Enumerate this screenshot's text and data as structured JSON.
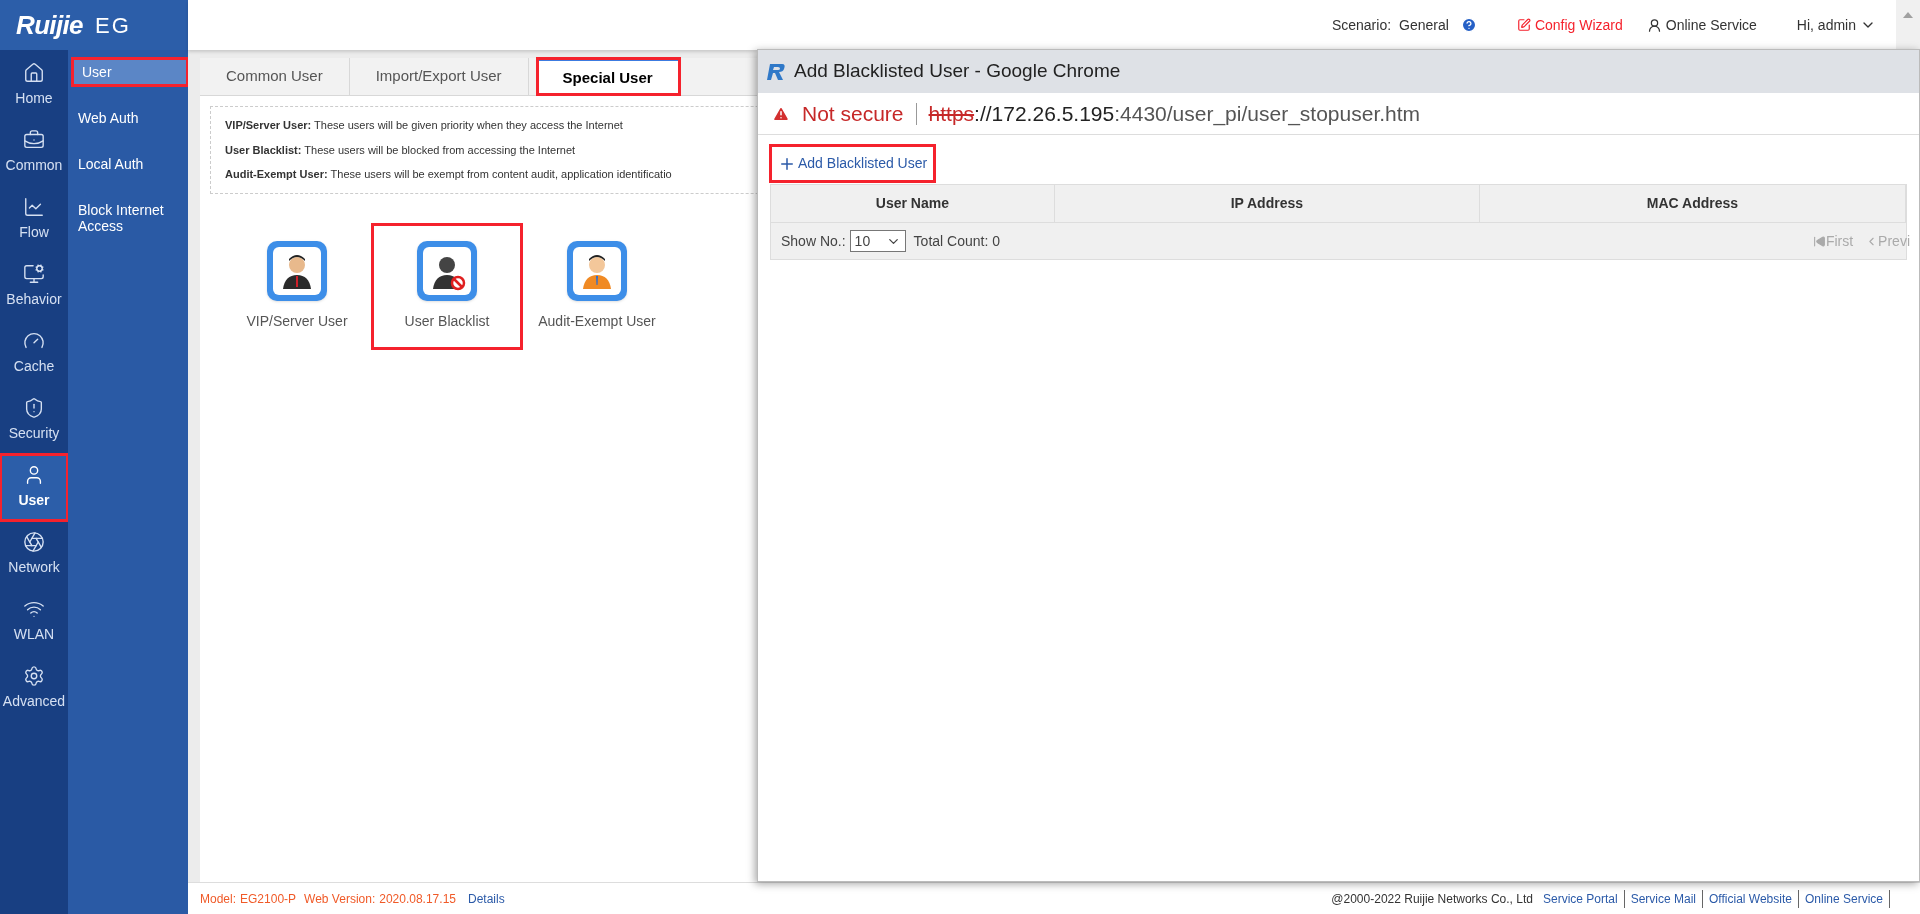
{
  "brand": {
    "logo": "Ruijie",
    "product": "EG"
  },
  "nav": [
    {
      "label": "Home",
      "selected": false,
      "highlighted": false
    },
    {
      "label": "Common",
      "selected": false,
      "highlighted": false
    },
    {
      "label": "Flow",
      "selected": false,
      "highlighted": false
    },
    {
      "label": "Behavior",
      "selected": false,
      "highlighted": false
    },
    {
      "label": "Cache",
      "selected": false,
      "highlighted": false
    },
    {
      "label": "Security",
      "selected": false,
      "highlighted": false
    },
    {
      "label": "User",
      "selected": true,
      "highlighted": true
    },
    {
      "label": "Network",
      "selected": false,
      "highlighted": false
    },
    {
      "label": "WLAN",
      "selected": false,
      "highlighted": false
    },
    {
      "label": "Advanced",
      "selected": false,
      "highlighted": false
    }
  ],
  "subnav": [
    {
      "label": "User",
      "selected": true,
      "highlighted": true
    },
    {
      "label": "Web Auth",
      "selected": false,
      "highlighted": false
    },
    {
      "label": "Local Auth",
      "selected": false,
      "highlighted": false
    },
    {
      "label": "Block Internet Access",
      "selected": false,
      "highlighted": false
    }
  ],
  "topbar": {
    "scenario_label": "Scenario:",
    "scenario_value": "General",
    "config_wizard": "Config Wizard",
    "online_service": "Online Service",
    "user_menu": "Hi, admin"
  },
  "tabs": [
    {
      "label": "Common User",
      "selected": false,
      "highlighted": false
    },
    {
      "label": "Import/Export User",
      "selected": false,
      "highlighted": false
    },
    {
      "label": "Special User",
      "selected": true,
      "highlighted": true
    }
  ],
  "info": [
    "**VIP/Server User:**  These users will be given priority when they access the Internet",
    "**User Blacklist:** These users will be blocked from accessing the Internet",
    "**Audit-Exempt User:** These users will be exempt from content audit, application identificatio"
  ],
  "tiles": [
    {
      "kind": "vip",
      "label": "VIP/Server User",
      "highlighted": false
    },
    {
      "kind": "blacklist",
      "label": "User Blacklist",
      "highlighted": true
    },
    {
      "kind": "exempt",
      "label": "Audit-Exempt User",
      "highlighted": false
    }
  ],
  "popup": {
    "title": "Add Blacklisted User - Google Chrome",
    "security": "Not secure",
    "url_scheme": "https",
    "url_host": "://172.26.5.195",
    "url_rest": ":4430/user_pi/user_stopuser.htm",
    "add_button": {
      "label": "Add Blacklisted User",
      "highlighted": true
    },
    "columns": [
      "User Name",
      "IP Address",
      "MAC Address"
    ],
    "show_label": "Show No.:",
    "page_size": "10",
    "total": "Total Count: 0",
    "first": "First",
    "previous": "Previ"
  },
  "footer": {
    "model_label": "Model:",
    "model": "EG2100-P",
    "version_label": "Web Version:",
    "version": "2020.08.17.15",
    "details": "Details",
    "copyright": "@2000-2022 Ruijie Networks Co., Ltd",
    "links": [
      "Service Portal",
      "Service Mail",
      "Official Website",
      "Online Service"
    ]
  }
}
